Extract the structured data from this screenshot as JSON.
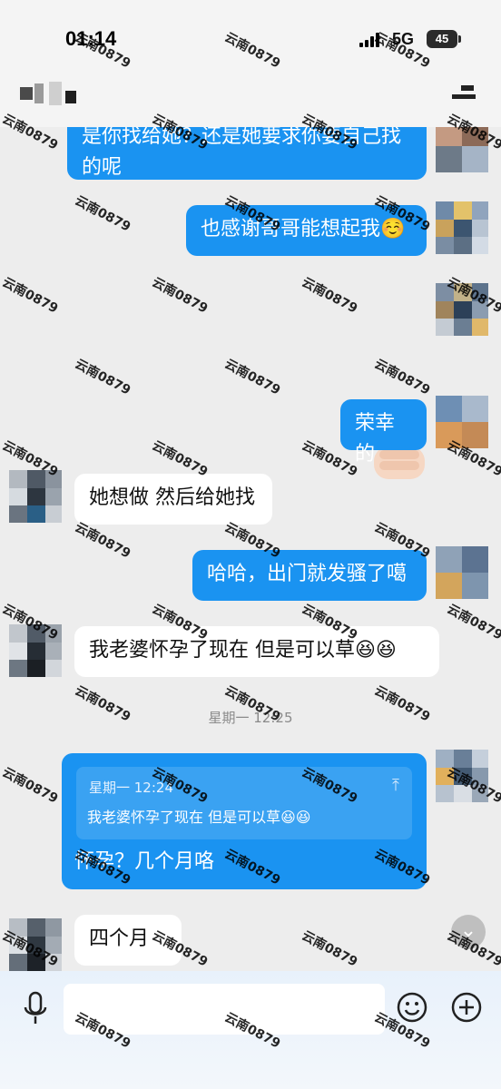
{
  "status_bar": {
    "time": "01:14",
    "network": "5G",
    "battery": "45"
  },
  "watermark": "云南0879",
  "messages": [
    {
      "side": "out",
      "text": "是你找给她？还是她要求你要自己找的呢"
    },
    {
      "side": "out",
      "text": "也感谢哥哥能想起我☺️"
    },
    {
      "side": "out",
      "sticker": "heart-hand"
    },
    {
      "side": "out",
      "text": "荣幸的"
    },
    {
      "side": "in",
      "text": "她想做  然后给她找"
    },
    {
      "side": "out",
      "text": "哈哈，出门就发骚了噶"
    },
    {
      "side": "in",
      "text": "我老婆怀孕了现在  但是可以草😆😆"
    },
    {
      "type": "time",
      "text": "星期一 12:25"
    },
    {
      "side": "out",
      "text": "怀孕？几个月咯",
      "quote": {
        "header": "星期一  12:24",
        "text": "我老婆怀孕了现在  但是可以草😆😆"
      }
    },
    {
      "side": "in",
      "text": "四个月"
    }
  ],
  "input": {
    "placeholder": ""
  }
}
